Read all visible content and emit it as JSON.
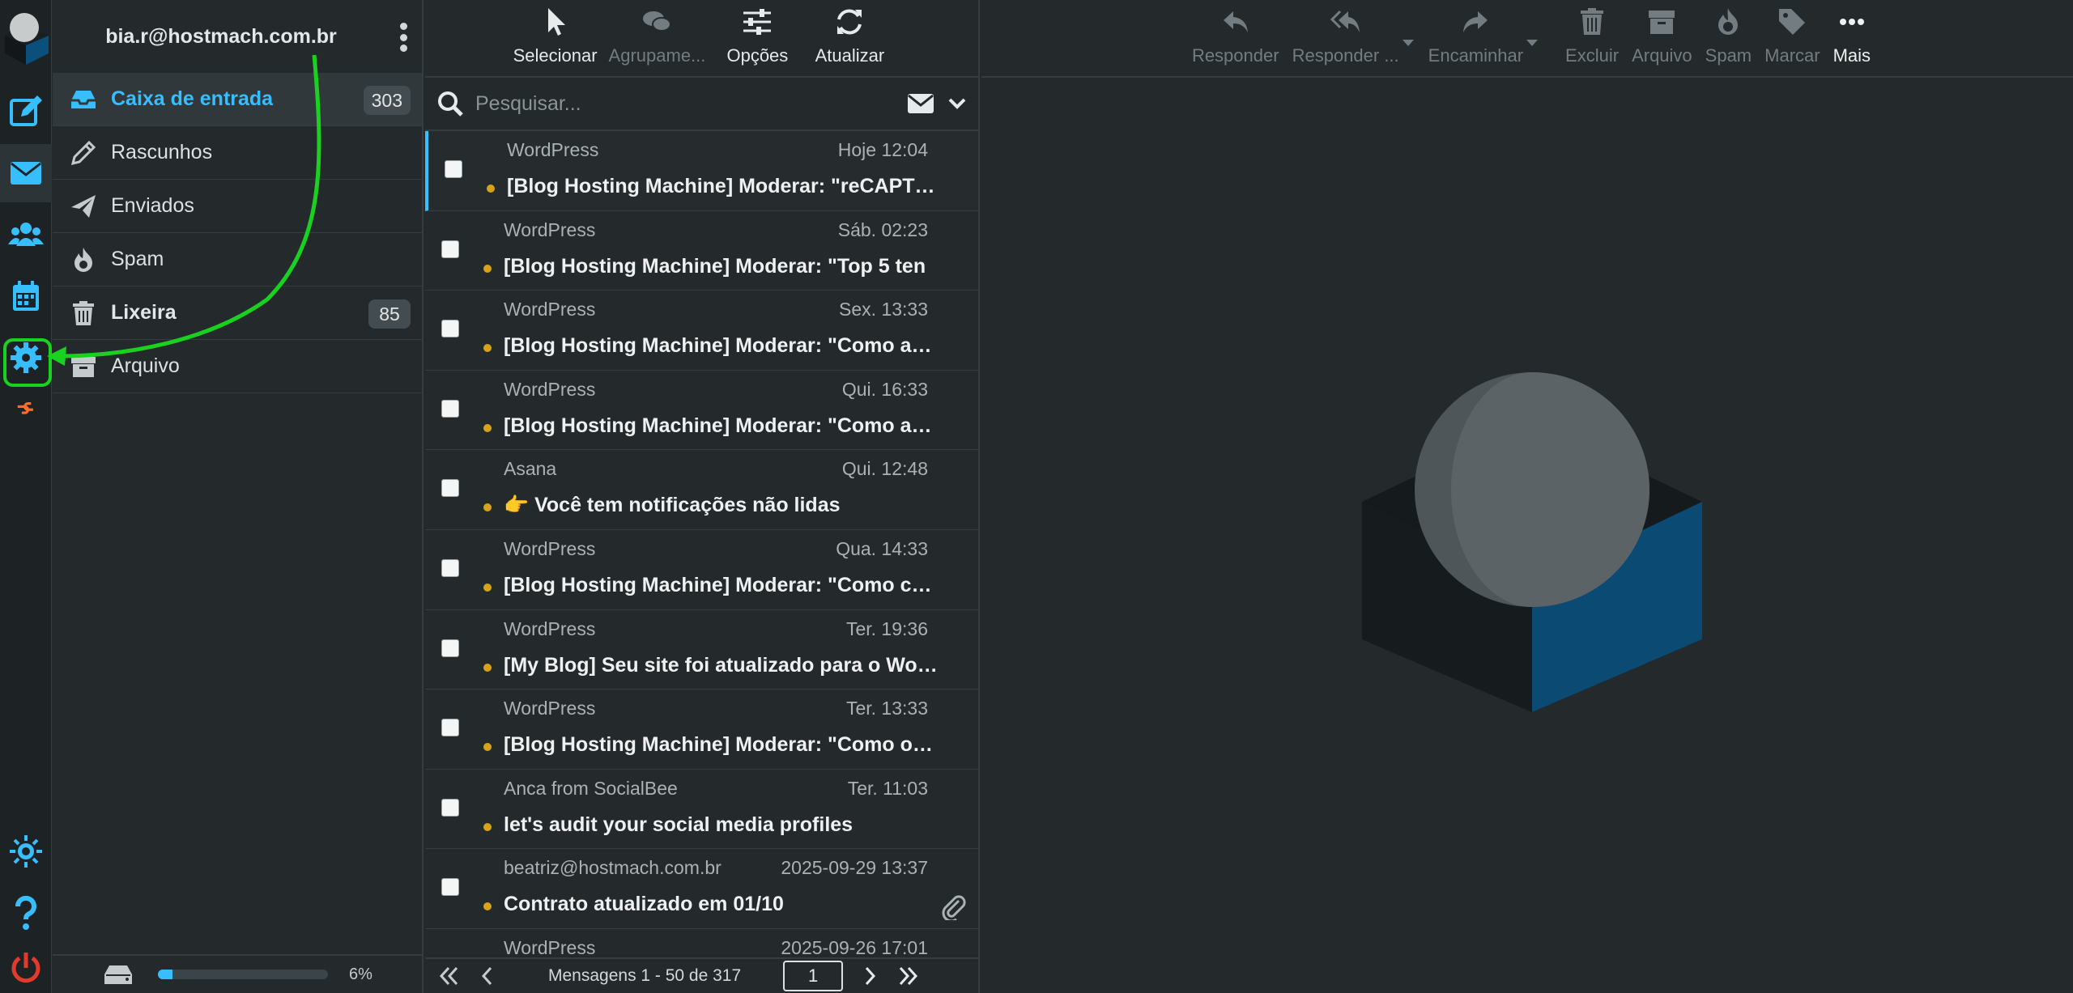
{
  "account": {
    "email": "bia.r@hostmach.com.br"
  },
  "folders": [
    {
      "label": "Caixa de entrada",
      "count": "303",
      "icon": "inbox-icon"
    },
    {
      "label": "Rascunhos",
      "count": "",
      "icon": "pencil-icon"
    },
    {
      "label": "Enviados",
      "count": "",
      "icon": "paper-plane-icon"
    },
    {
      "label": "Spam",
      "count": "",
      "icon": "fire-icon"
    },
    {
      "label": "Lixeira",
      "count": "85",
      "icon": "trash-icon"
    },
    {
      "label": "Arquivo",
      "count": "",
      "icon": "archive-icon"
    }
  ],
  "quota": {
    "percent_label": "6%",
    "fraction": 0.06
  },
  "list_toolbar": {
    "select": "Selecionar",
    "group": "Agrupame...",
    "options": "Opções",
    "refresh": "Atualizar"
  },
  "search": {
    "placeholder": "Pesquisar..."
  },
  "messages": [
    {
      "from": "WordPress",
      "date": "Hoje 12:04",
      "subject": "[Blog Hosting Machine] Moderar: \"reCAPTCHA",
      "attachment": false
    },
    {
      "from": "WordPress",
      "date": "Sáb. 02:23",
      "subject": "[Blog Hosting Machine] Moderar: \"Top 5 ten",
      "attachment": false
    },
    {
      "from": "WordPress",
      "date": "Sex. 13:33",
      "subject": "[Blog Hosting Machine] Moderar: \"Como acess",
      "attachment": false
    },
    {
      "from": "WordPress",
      "date": "Qui. 16:33",
      "subject": "[Blog Hosting Machine] Moderar: \"Como acess",
      "attachment": false
    },
    {
      "from": "Asana",
      "date": "Qui. 12:48",
      "subject": "👉 Você tem notificações não lidas",
      "attachment": false
    },
    {
      "from": "WordPress",
      "date": "Qua. 14:33",
      "subject": "[Blog Hosting Machine] Moderar: \"Como conf",
      "attachment": false
    },
    {
      "from": "WordPress",
      "date": "Ter. 19:36",
      "subject": "[My Blog] Seu site foi atualizado para o WordPress",
      "attachment": false
    },
    {
      "from": "WordPress",
      "date": "Ter. 13:33",
      "subject": "[Blog Hosting Machine] Moderar: \"Como obter",
      "attachment": false
    },
    {
      "from": "Anca from SocialBee",
      "date": "Ter. 11:03",
      "subject": "let's audit your social media profiles",
      "attachment": false
    },
    {
      "from": "beatriz@hostmach.com.br",
      "date": "2025-09-29 13:37",
      "subject": "Contrato atualizado em 01/10",
      "attachment": true
    },
    {
      "from": "WordPress",
      "date": "2025-09-26 17:01",
      "subject": "",
      "attachment": false
    }
  ],
  "pager": {
    "label": "Mensagens 1 - 50 de 317",
    "page": "1"
  },
  "content_toolbar": {
    "reply": "Responder",
    "reply_all": "Responder ...",
    "forward": "Encaminhar",
    "delete": "Excluir",
    "archive": "Arquivo",
    "spam": "Spam",
    "mark": "Marcar",
    "more": "Mais"
  },
  "colors": {
    "accent": "#37beff",
    "unread_dot": "#d9a319",
    "annotation": "#19d11f",
    "cpanel": "#ff6c2c",
    "logout": "#e23b2e"
  }
}
